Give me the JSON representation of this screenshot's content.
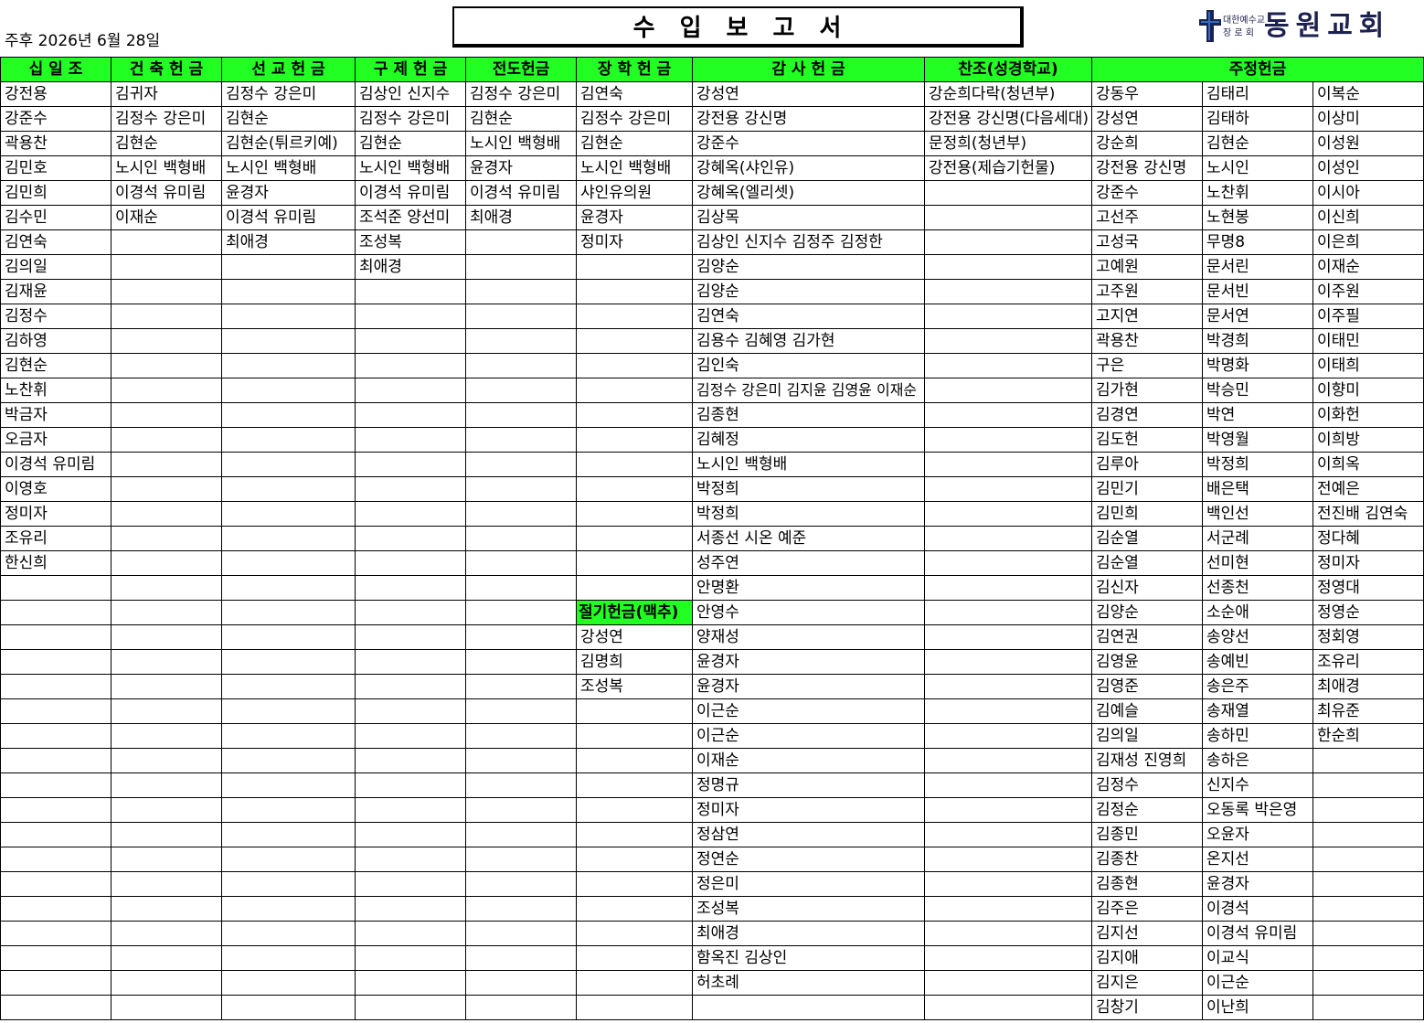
{
  "report": {
    "date": "주후 2026년 6월 28일",
    "title": "수 입 보 고 서"
  },
  "church_logo": {
    "icon": "cross-icon",
    "denomination_line1": "대한예수교",
    "denomination_line2": "장 로 회",
    "name": "동원교회"
  },
  "colors": {
    "header_fill": "#22ff22",
    "grid_line": "#000000",
    "text": "#000000",
    "logo_navy": "#1c2150",
    "logo_blue": "#2f6fc0"
  },
  "columns": [
    {
      "header": "십 일 조",
      "entries": [
        "강전용",
        "강준수",
        "곽용찬",
        "김민호",
        "김민희",
        "김수민",
        "김연숙",
        "김의일",
        "김재윤",
        "김정수",
        "김하영",
        "김현순",
        "노찬휘",
        "박금자",
        "오금자",
        "이경석 유미림",
        "이영호",
        "정미자",
        "조유리",
        "한신희"
      ]
    },
    {
      "header": "건 축 헌 금",
      "entries": [
        "김귀자",
        "김정수 강은미",
        "김현순",
        "노시인 백형배",
        "이경석 유미림",
        "이재순"
      ]
    },
    {
      "header": "선 교 헌 금",
      "entries": [
        "김정수 강은미",
        "김현순",
        "김현순(튀르키예)",
        "노시인 백형배",
        "윤경자",
        "이경석 유미림",
        "최애경"
      ]
    },
    {
      "header": "구 제 헌 금",
      "entries": [
        "김상인 신지수",
        "김정수 강은미",
        "김현순",
        "노시인 백형배",
        "이경석 유미림",
        "조석준 양선미",
        "조성복",
        "최애경"
      ]
    },
    {
      "header": "전도헌금",
      "entries": [
        "김정수 강은미",
        "김현순",
        "노시인 백형배",
        "윤경자",
        "이경석 유미림",
        "최애경"
      ]
    },
    {
      "header": "장 학 헌 금",
      "entries": [
        "김연숙",
        "김정수 강은미",
        "김현순",
        "노시인 백형배",
        "샤인유의원",
        "윤경자",
        "정미자",
        "",
        "",
        "",
        "",
        "",
        "",
        "",
        "",
        "",
        "",
        "",
        "",
        "",
        "",
        {
          "subheader": "절기헌금(맥추)"
        },
        "강성연",
        "김명희",
        "조성복"
      ]
    },
    {
      "header": "감 사 헌 금",
      "entries": [
        "강성연",
        "강전용 강신명",
        "강준수",
        "강혜옥(샤인유)",
        "강혜옥(엘리셋)",
        "김상목",
        "김상인 신지수 김정주 김정한",
        "김양순",
        "김양순",
        "김연숙",
        "김용수 김혜영 김가현",
        "김인숙",
        "김정수 강은미 김지윤 김영윤 이재순",
        "김종현",
        "김혜정",
        "노시인 백형배",
        "박정희",
        "박정희",
        "서종선 시온 예준",
        "성주연",
        "안명환",
        "안영수",
        "양재성",
        "윤경자",
        "윤경자",
        "이근순",
        "이근순",
        "이재순",
        "정명규",
        "정미자",
        "정삼연",
        "정연순",
        "정은미",
        "조성복",
        "최애경",
        "함옥진 김상인",
        "허초례"
      ]
    },
    {
      "header": "찬조(성경학교)",
      "entries": [
        "강순희다락(청년부)",
        "강전용 강신명(다음세대)",
        "문정희(청년부)",
        "강전용(제습기헌물)"
      ]
    },
    {
      "header": "주정헌금",
      "subcolumns": [
        [
          "강동우",
          "강성연",
          "강순희",
          "강전용 강신명",
          "강준수",
          "고선주",
          "고성국",
          "고예원",
          "고주원",
          "고지연",
          "곽용찬",
          "구은",
          "김가현",
          "김경연",
          "김도헌",
          "김루아",
          "김민기",
          "김민희",
          "김순열",
          "김순열",
          "김신자",
          "김양순",
          "김연권",
          "김영윤",
          "김영준",
          "김예슬",
          "김의일",
          "김재성 진영희",
          "김정수",
          "김정순",
          "김종민",
          "김종찬",
          "김종현",
          "김주은",
          "김지선",
          "김지애",
          "김지은",
          "김창기"
        ],
        [
          "김태리",
          "김태하",
          "김현순",
          "노시인",
          "노찬휘",
          "노현봉",
          "무명8",
          "문서린",
          "문서빈",
          "문서연",
          "박경희",
          "박명화",
          "박승민",
          "박연",
          "박영월",
          "박정희",
          "배은택",
          "백인선",
          "서군례",
          "선미현",
          "선종천",
          "소순애",
          "송양선",
          "송예빈",
          "송은주",
          "송재열",
          "송하민",
          "송하은",
          "신지수",
          "오동록 박은영",
          "오윤자",
          "온지선",
          "윤경자",
          "이경석",
          "이경석 유미림",
          "이교식",
          "이근순",
          "이난희"
        ],
        [
          "이복순",
          "이상미",
          "이성원",
          "이성인",
          "이시아",
          "이신희",
          "이은희",
          "이재순",
          "이주원",
          "이주필",
          "이태민",
          "이태희",
          "이향미",
          "이화헌",
          "이희방",
          "이희옥",
          "전예은",
          "전진배 김연숙",
          "정다혜",
          "정미자",
          "정영대",
          "정영순",
          "정회영",
          "조유리",
          "최애경",
          "최유준",
          "한순희"
        ]
      ]
    }
  ]
}
